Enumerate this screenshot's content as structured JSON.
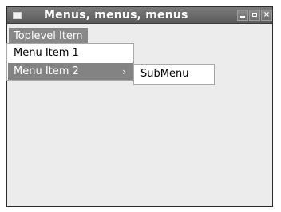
{
  "window": {
    "title": "Menus, menus, menus"
  },
  "menubar": {
    "items": [
      {
        "label": "Toplevel Item"
      }
    ]
  },
  "menu": {
    "items": [
      {
        "label": "Menu Item 1"
      },
      {
        "label": "Menu Item 2",
        "submenu_arrow": "›"
      }
    ]
  },
  "submenu": {
    "items": [
      {
        "label": "SubMenu"
      }
    ]
  },
  "icons": {
    "window_menu": "window-menu-icon",
    "minimize": "minimize-icon",
    "maximize": "maximize-icon",
    "close": "close-icon",
    "submenu_arrow": "chevron-right-icon"
  },
  "colors": {
    "titlebar": "#6b6b6b",
    "highlight": "#838383",
    "menu_background": "#ffffff",
    "window_background": "#ececec"
  }
}
